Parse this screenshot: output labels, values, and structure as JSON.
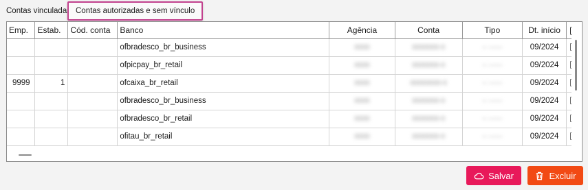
{
  "tabs": [
    {
      "label": "Contas vinculadas",
      "active": false
    },
    {
      "label": "Contas autorizadas e sem vínculo",
      "active": true
    }
  ],
  "table": {
    "columns": [
      "Emp.",
      "Estab.",
      "Cód. conta",
      "Banco",
      "Agência",
      "Conta",
      "Tipo",
      "Dt. início"
    ],
    "rows": [
      {
        "emp": "",
        "estab": "",
        "cod": "",
        "banco": "ofbradesco_br_business",
        "agencia": "0000",
        "conta": "0000000-0",
        "tipo": "-- ------",
        "dt": "09/2024"
      },
      {
        "emp": "",
        "estab": "",
        "cod": "",
        "banco": "ofpicpay_br_retail",
        "agencia": "0000",
        "conta": "0000000-0",
        "tipo": "-- ------",
        "dt": "09/2024"
      },
      {
        "emp": "9999",
        "estab": "1",
        "cod": "",
        "banco": "ofcaixa_br_retail",
        "agencia": "0000",
        "conta": "00000000-0",
        "tipo": "-- ------",
        "dt": "09/2024"
      },
      {
        "emp": "",
        "estab": "",
        "cod": "",
        "banco": "ofbradesco_br_business",
        "agencia": "0000",
        "conta": "0000000-0",
        "tipo": "-- ------",
        "dt": "09/2024"
      },
      {
        "emp": "",
        "estab": "",
        "cod": "",
        "banco": "ofbradesco_br_retail",
        "agencia": "0000",
        "conta": "0000000-0",
        "tipo": "-- ------",
        "dt": "09/2024"
      },
      {
        "emp": "",
        "estab": "",
        "cod": "",
        "banco": "ofitau_br_retail",
        "agencia": "0000",
        "conta": "0000000-0",
        "tipo": "-- ------",
        "dt": "09/2024"
      }
    ]
  },
  "buttons": {
    "save_label": "Salvar",
    "save_icon": "cloud-icon",
    "save_color": "#e8195a",
    "delete_label": "Excluir",
    "delete_icon": "trash-icon",
    "delete_color": "#f24a14"
  },
  "colors": {
    "active_tab_border": "#c2418e"
  }
}
